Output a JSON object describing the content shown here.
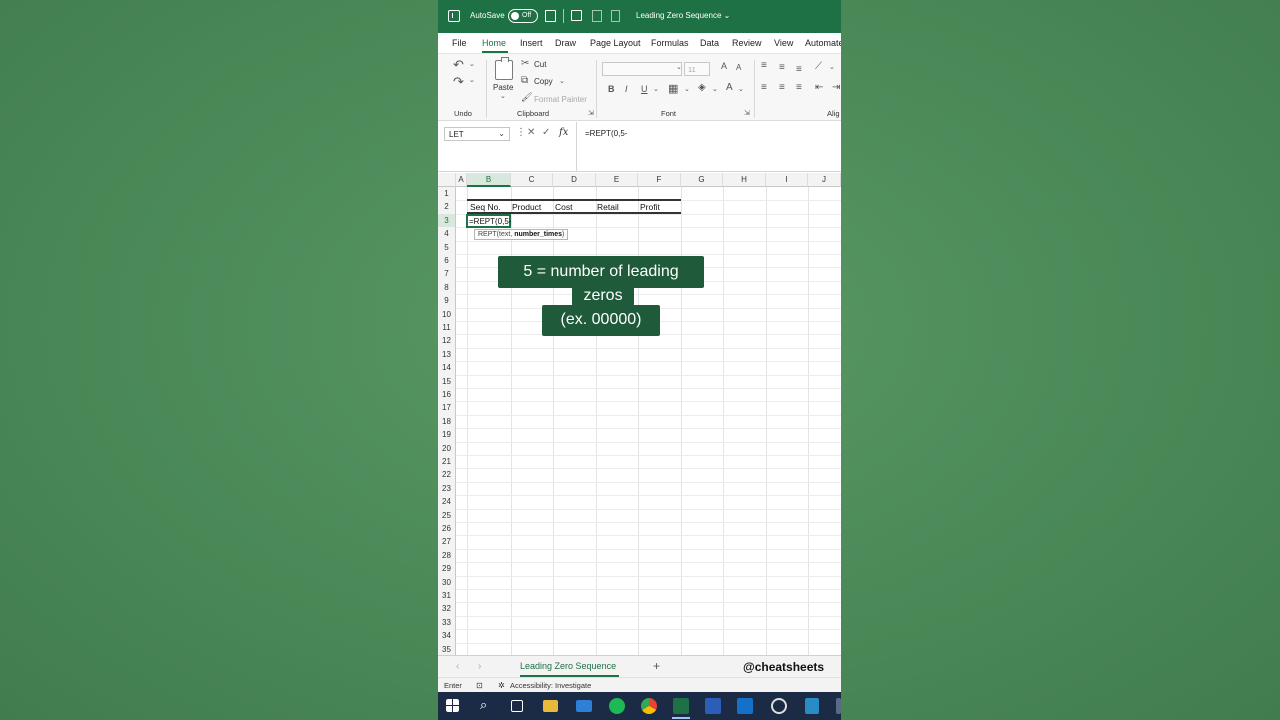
{
  "titlebar": {
    "autosave_label": "AutoSave",
    "autosave_state": "Off",
    "document_title": "Leading Zero Sequence ⌄"
  },
  "tabs": [
    "File",
    "Home",
    "Insert",
    "Draw",
    "Page Layout",
    "Formulas",
    "Data",
    "Review",
    "View",
    "Automate"
  ],
  "ribbon": {
    "undo_group": "Undo",
    "clipboard_group": "Clipboard",
    "font_group": "Font",
    "alignment_group": "Alig",
    "paste": "Paste",
    "cut": "Cut",
    "copy": "Copy",
    "format_painter": "Format Painter",
    "font_size": "11",
    "bold": "B",
    "italic": "I",
    "underline": "U"
  },
  "formula_bar": {
    "name_box": "LET",
    "formula": "=REPT(0,5-"
  },
  "grid": {
    "columns": [
      "A",
      "B",
      "C",
      "D",
      "E",
      "F",
      "G",
      "H",
      "I",
      "J"
    ],
    "rows": [
      "1",
      "2",
      "3",
      "4",
      "5",
      "6",
      "7",
      "8",
      "9",
      "10",
      "11",
      "12",
      "13",
      "14",
      "15",
      "16",
      "17",
      "18",
      "19",
      "20",
      "21",
      "22",
      "23",
      "24",
      "25",
      "26",
      "27",
      "28",
      "29",
      "30",
      "31",
      "32",
      "33",
      "34",
      "35"
    ],
    "headers": {
      "seq": "Seq No.",
      "product": "Product",
      "cost": "Cost",
      "retail": "Retail",
      "profit": "Profit"
    },
    "active_cell_text": "=REPT(0,5-",
    "tooltip_fn": "REPT(",
    "tooltip_arg1": "text, ",
    "tooltip_arg2": "number_times",
    "tooltip_close": ")"
  },
  "callout": {
    "line1": "5 = number of leading",
    "line2": "zeros",
    "line3": "(ex. 00000)"
  },
  "sheetbar": {
    "sheet_name": "Leading Zero Sequence",
    "add": "+",
    "watermark": "@cheatsheets"
  },
  "statusbar": {
    "mode": "Enter",
    "accessibility": "Accessibility: Investigate"
  },
  "colors": {
    "excel_green": "#1e7145",
    "background": "#4b8a58",
    "callout": "#1f5a3a",
    "taskbar": "#1c2b45"
  }
}
